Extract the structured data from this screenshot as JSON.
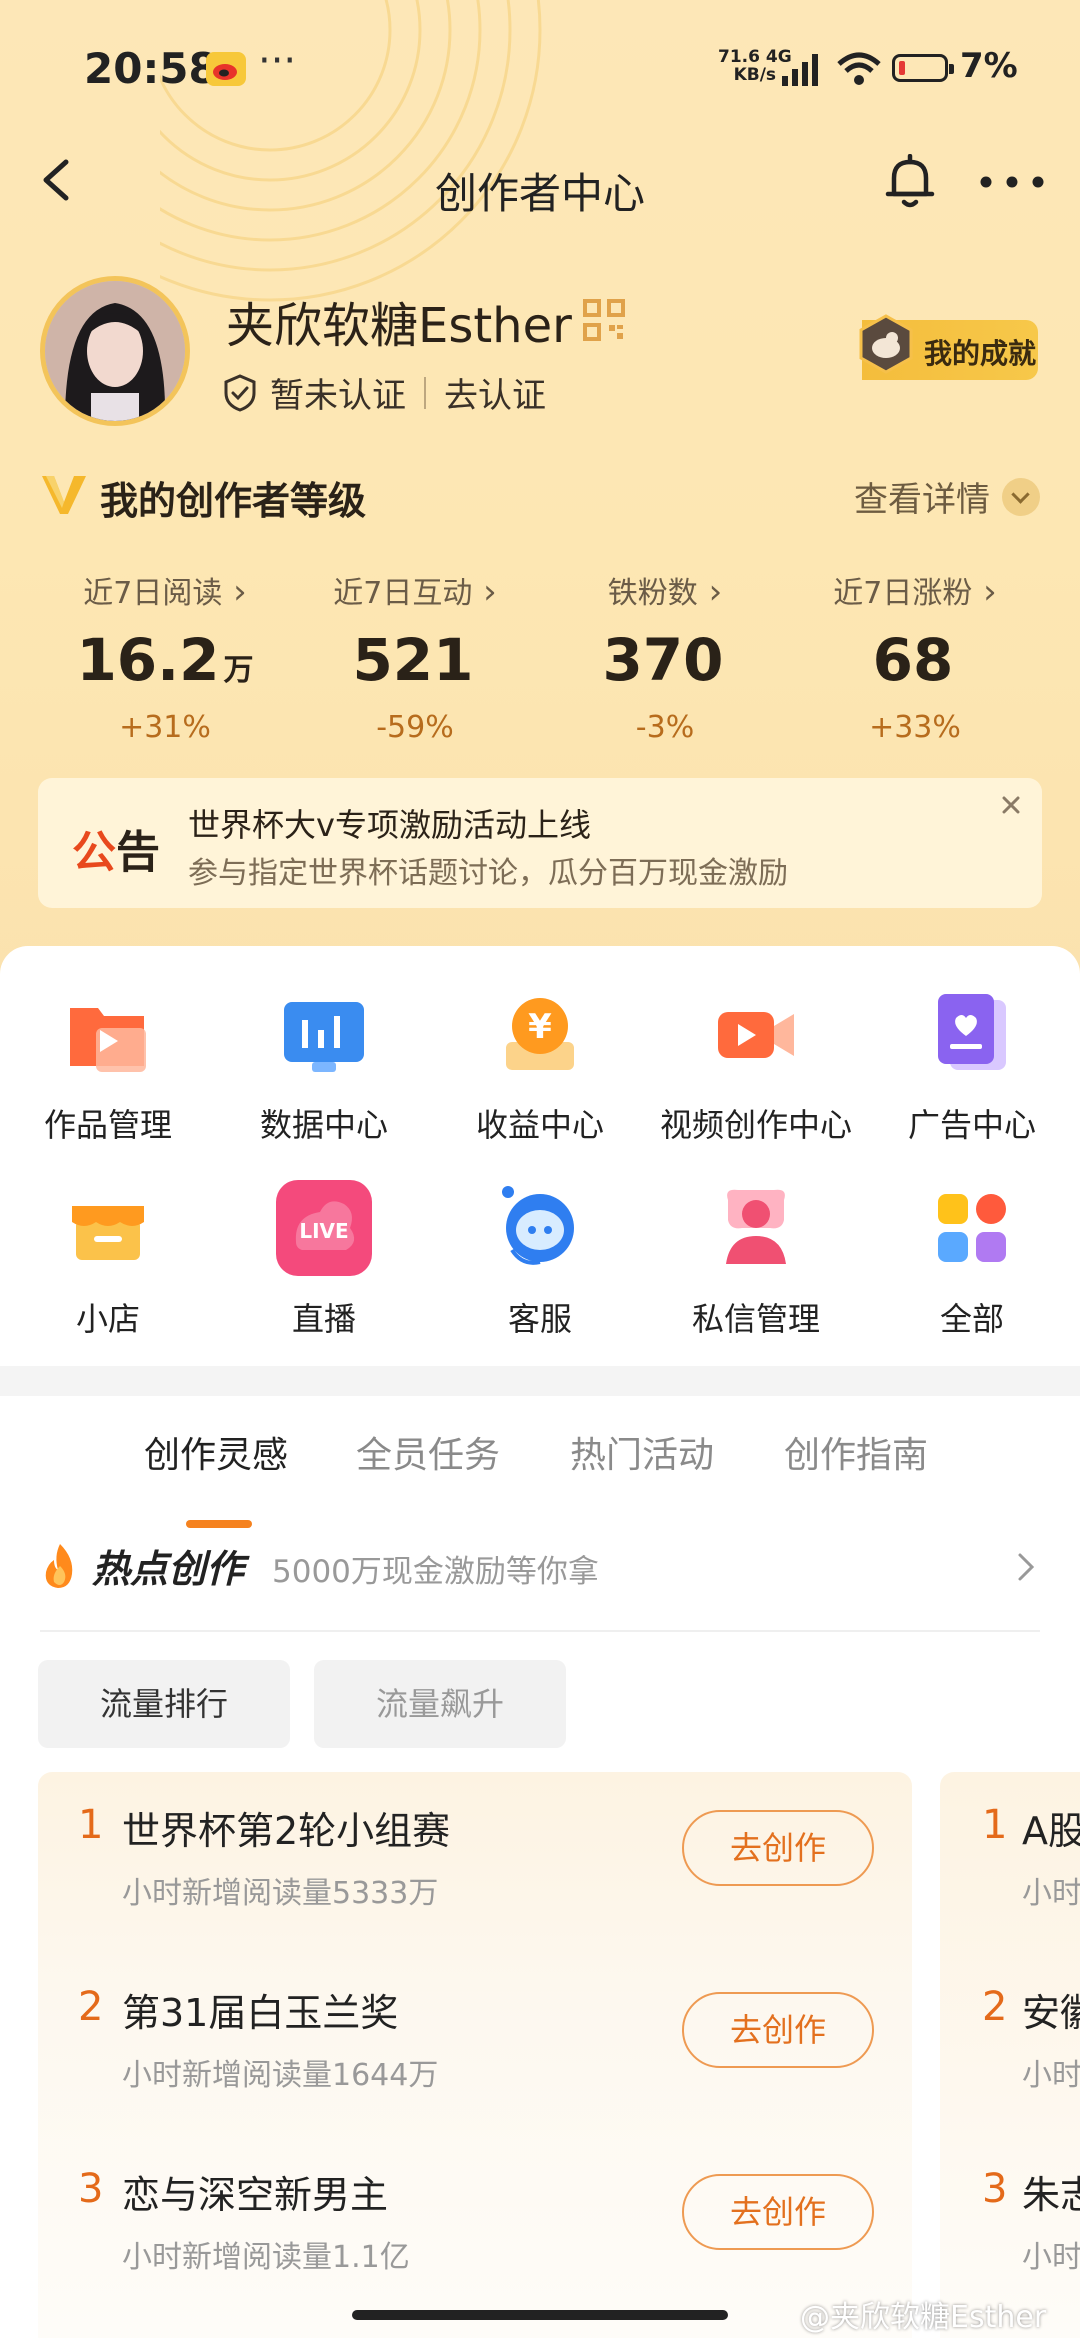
{
  "status_bar": {
    "time": "20:58",
    "overflow": "···",
    "net_speed_value": "71.6",
    "net_speed_unit": "KB/s",
    "net_type": "4G",
    "battery": "7%"
  },
  "header": {
    "title": "创作者中心"
  },
  "profile": {
    "username": "夹欣软糖Esther",
    "verify_status": "暂未认证",
    "verify_action": "去认证",
    "achievement": "我的成就"
  },
  "level": {
    "title": "我的创作者等级",
    "detail_link": "查看详情"
  },
  "stats": [
    {
      "label": "近7日阅读",
      "value": "16.2",
      "unit": "万",
      "change": "+31%"
    },
    {
      "label": "近7日互动",
      "value": "521",
      "unit": "",
      "change": "-59%"
    },
    {
      "label": "铁粉数",
      "value": "370",
      "unit": "",
      "change": "-3%"
    },
    {
      "label": "近7日涨粉",
      "value": "68",
      "unit": "",
      "change": "+33%"
    }
  ],
  "notice": {
    "tag_red": "公",
    "tag_black": "告",
    "headline": "世界杯大v专项激励活动上线",
    "subline": "参与指定世界杯话题讨论，瓜分百万现金激励"
  },
  "tools": [
    {
      "label": "作品管理",
      "icon": "works-folder-icon"
    },
    {
      "label": "数据中心",
      "icon": "data-chart-icon"
    },
    {
      "label": "收益中心",
      "icon": "yuan-coin-icon"
    },
    {
      "label": "视频创作中心",
      "icon": "video-camera-icon"
    },
    {
      "label": "广告中心",
      "icon": "ad-heart-icon"
    },
    {
      "label": "小店",
      "icon": "shop-icon"
    },
    {
      "label": "直播",
      "icon": "live-icon"
    },
    {
      "label": "客服",
      "icon": "customer-service-icon"
    },
    {
      "label": "私信管理",
      "icon": "message-person-icon"
    },
    {
      "label": "全部",
      "icon": "all-grid-icon"
    }
  ],
  "tabs": [
    "创作灵感",
    "全员任务",
    "热门活动",
    "创作指南"
  ],
  "hot": {
    "title": "热点创作",
    "subtitle": "5000万现金激励等你拿"
  },
  "filters": [
    "流量排行",
    "流量飙升"
  ],
  "ranking": [
    {
      "rank": "1",
      "title": "世界杯第2轮小组赛",
      "sub": "小时新增阅读量5333万",
      "action": "去创作"
    },
    {
      "rank": "2",
      "title": "第31届白玉兰奖",
      "sub": "小时新增阅读量1644万",
      "action": "去创作"
    },
    {
      "rank": "3",
      "title": "恋与深空新男主",
      "sub": "小时新增阅读量1.1亿",
      "action": "去创作"
    }
  ],
  "ranking_peek": [
    {
      "rank": "1",
      "title": "A股",
      "sub": "小时"
    },
    {
      "rank": "2",
      "title": "安徽",
      "sub": "小时"
    },
    {
      "rank": "3",
      "title": "朱志",
      "sub": "小时"
    }
  ],
  "watermark": "@夹欣软糖Esther",
  "colors": {
    "accent": "#f5821f",
    "rank": "#e46a1a",
    "hero_bg": "#fde7b7",
    "notice_red": "#e8491d"
  }
}
